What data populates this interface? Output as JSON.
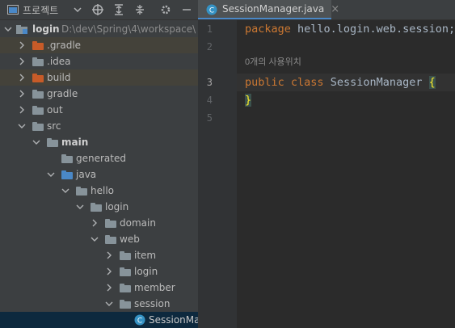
{
  "project_toolbar": {
    "view_label": "프로젝트",
    "icons": [
      "project-view-icon",
      "chevron-down-icon",
      "locate-icon",
      "expand-all-icon",
      "collapse-all-icon",
      "gear-icon",
      "minimize-icon"
    ]
  },
  "tree": {
    "root_label": "login",
    "root_path": "D:\\dev\\Spring\\4\\workspace\\",
    "items": [
      {
        "label": ".gradle"
      },
      {
        "label": ".idea"
      },
      {
        "label": "build"
      },
      {
        "label": "gradle"
      },
      {
        "label": "out"
      },
      {
        "label": "src"
      },
      {
        "label": "main"
      },
      {
        "label": "generated"
      },
      {
        "label": "java"
      },
      {
        "label": "hello"
      },
      {
        "label": "login"
      },
      {
        "label": "domain"
      },
      {
        "label": "web"
      },
      {
        "label": "item"
      },
      {
        "label": "login"
      },
      {
        "label": "member"
      },
      {
        "label": "session"
      },
      {
        "label": "SessionManager"
      }
    ]
  },
  "editor": {
    "tab_label": "SessionManager.java",
    "tab_close": "×",
    "line_numbers": [
      "1",
      "2",
      "3",
      "4",
      "5"
    ],
    "line1_kw": "package",
    "line1_rest": " hello.login.web.session;",
    "usage_hint": "0개의 사용위치",
    "line3_kw1": "public",
    "line3_kw2": "class",
    "line3_name": "SessionManager",
    "line3_brace": "{",
    "line4_brace": "}"
  },
  "colors": {
    "panel_bg": "#3c3f41",
    "editor_bg": "#2b2b2b",
    "keyword": "#cc7832",
    "selection": "#0d293e",
    "orange_folder": "#c75b28",
    "blue_folder": "#87939a"
  }
}
